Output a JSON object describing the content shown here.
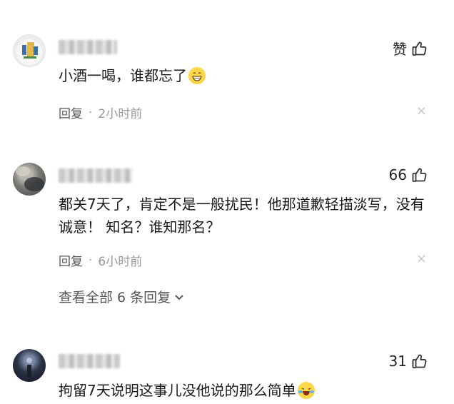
{
  "comments": [
    {
      "like_label": "赞",
      "text": "小酒一喝，谁都忘了",
      "emoji": "grin-emoji",
      "reply_label": "回复",
      "time": "2小时前"
    },
    {
      "like_count": "66",
      "text": "都关7天了，肯定不是一般扰民！他那道歉轻描淡写，没有诚意！ 知名？谁知那名？",
      "reply_label": "回复",
      "time": "6小时前",
      "more_replies": "查看全部 6 条回复"
    },
    {
      "like_count": "31",
      "text": "拘留7天说明这事儿没他说的那么简单",
      "emoji": "laughing-crying-emoji"
    }
  ],
  "icons": {
    "like": "thumbs-up-icon",
    "close": "close-icon",
    "expand": "chevron-down-icon"
  },
  "separator": "·",
  "close_glyph": "×"
}
